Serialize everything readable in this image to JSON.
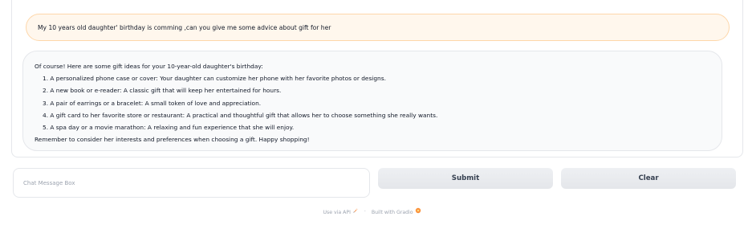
{
  "chat": {
    "user_message": "My 10 years old daughter' birthday is comming ,can you give me some advice about gift for her",
    "bot_intro": "Of course! Here are some gift ideas for your 10-year-old daughter's birthday:",
    "bot_items": [
      "1. A personalized phone case or cover: Your daughter can customize her phone with her favorite photos or designs.",
      "2. A new book or e-reader: A classic gift that will keep her entertained for hours.",
      "3. A pair of earrings or a bracelet: A small token of love and appreciation.",
      "4. A gift card to her favorite store or restaurant: A practical and thoughtful gift that allows her to choose something she really wants.",
      "5. A spa day or a movie marathon: A relaxing and fun experience that she will enjoy."
    ],
    "bot_outro": "Remember to consider her interests and preferences when choosing a gift. Happy shopping!"
  },
  "input": {
    "placeholder": "Chat Message Box",
    "value": ""
  },
  "buttons": {
    "submit_label": "Submit",
    "clear_label": "Clear"
  },
  "footer": {
    "api_label": "Use via API",
    "separator": "·",
    "built_label": "Built with Gradio",
    "api_icon": "rocket-icon",
    "built_icon": "gradio-logo-icon"
  }
}
